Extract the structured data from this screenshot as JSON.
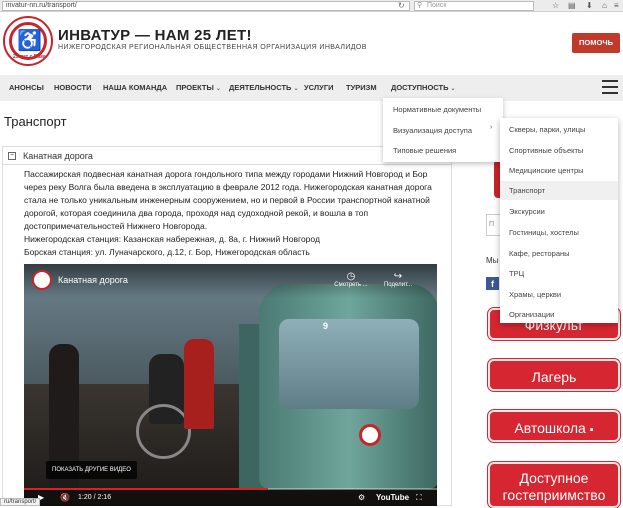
{
  "browser": {
    "url": "invatur-nn.ru/transport/",
    "search_placeholder": "Поиск"
  },
  "header": {
    "logo_text": "25 лет с Вами",
    "title": "ИНВАТУР — НАМ 25 ЛЕТ!",
    "subtitle": "НИЖЕГОРОДСКАЯ РЕГИОНАЛЬНАЯ ОБЩЕСТВЕННАЯ ОРГАНИЗАЦИЯ ИНВАЛИДОВ",
    "help_button": "ПОМОЧЬ"
  },
  "nav": {
    "items": [
      {
        "label": "АНОНСЫ",
        "has_dropdown": false
      },
      {
        "label": "НОВОСТИ",
        "has_dropdown": false
      },
      {
        "label": "НАША КОМАНДА",
        "has_dropdown": false
      },
      {
        "label": "ПРОЕКТЫ",
        "has_dropdown": true
      },
      {
        "label": "ДЕЯТЕЛЬНОСТЬ",
        "has_dropdown": true
      },
      {
        "label": "УСЛУГИ",
        "has_dropdown": false
      },
      {
        "label": "ТУРИЗМ",
        "has_dropdown": false
      },
      {
        "label": "ДОСТУПНОСТЬ",
        "has_dropdown": true
      }
    ]
  },
  "dropdown_dostupnost": {
    "items": [
      "Нормативные документы",
      "Визуализация доступа",
      "Типовые решения"
    ]
  },
  "dropdown_vizualizatsiya": {
    "items": [
      "Скверы, парки, улицы",
      "Спортивные объекты",
      "Медицинские центры",
      "Транспорт",
      "Экскурсии",
      "Гостиницы, хостелы",
      "Кафе, рестораны",
      "ТРЦ",
      "Храмы, церкви",
      "Организации"
    ],
    "active": "Транспорт"
  },
  "page": {
    "title": "Транспорт",
    "accordion_title": "Канатная дорога",
    "paragraph": "Пассажирская подвесная канатная дорога гондольного типа между городами Нижний Новгород и Бор через реку Волга была введена в эксплуатацию в феврале 2012 года. Нижегородская канатная дорога стала не только уникальным инженерным сооружением, но и первой в России транспортной канатной дорогой, которая соединила два города, проходя над судоходной рекой, и вошла в топ достопримечательностей Нижнего Новгорода.",
    "station1": "Нижегородская станция: Казанская набережная, д. 8а, г. Нижний Новгород",
    "station2": "Борская станция: ул. Луначарского, д.12, г. Бор, Нижегородская область"
  },
  "video": {
    "title": "Канатная дорога",
    "watch_later": "Смотреть ...",
    "share": "Поделит...",
    "more_videos": "ПОКАЗАТЬ ДРУГИЕ ВИДЕО",
    "time": "1:20 / 2:16",
    "progress": 0.59,
    "brand": "YouTube",
    "car_number": "9"
  },
  "sidebar": {
    "input_partial": "П",
    "my_label": "Мы",
    "buttons": [
      "Физкульт",
      "Лагерь",
      "Автошкола",
      "Доступное гостеприимство"
    ]
  },
  "status_url": "ru/transport/",
  "colors": {
    "brand_red": "#c7252b",
    "button_red": "#d62631",
    "help_button": "#c0392b",
    "nav_bg": "#eeeeee"
  }
}
